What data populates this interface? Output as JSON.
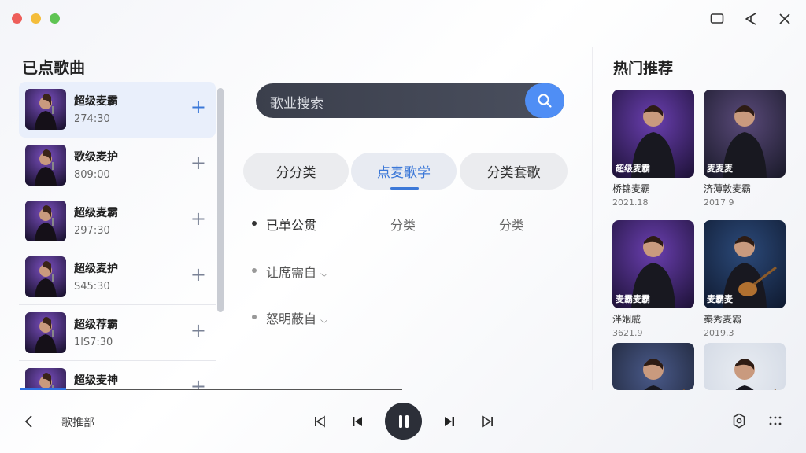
{
  "window": {
    "traffic_lights": [
      "#ee5e5a",
      "#f4bd3b",
      "#5fc453"
    ]
  },
  "left_panel": {
    "title": "已点歌曲",
    "items": [
      {
        "title": "超级麦霸",
        "sub": "274:30",
        "active": true
      },
      {
        "title": "歌级麦护",
        "sub": "809:00",
        "active": false
      },
      {
        "title": "超级麦霸",
        "sub": "297:30",
        "active": false
      },
      {
        "title": "超级麦护",
        "sub": "S45:30",
        "active": false
      },
      {
        "title": "超级荐霸",
        "sub": "1lS7:30",
        "active": false
      },
      {
        "title": "超级麦神",
        "sub": "",
        "active": false
      }
    ],
    "progress": 0.12
  },
  "search": {
    "placeholder": "歌业搜索"
  },
  "tabs": [
    {
      "label": "分分类",
      "active": false
    },
    {
      "label": "点麦歌学",
      "active": true
    },
    {
      "label": "分类套歌",
      "active": false
    }
  ],
  "options": {
    "row1": [
      "已单公贯",
      "分类",
      "分类"
    ],
    "dropdowns": [
      "让席需自",
      "怒明蔽自"
    ]
  },
  "right_panel": {
    "title": "热门推荐",
    "cards": [
      {
        "tag": "超级麦霸",
        "name": "桥锦麦霸",
        "sub": "2021.18"
      },
      {
        "tag": "麦麦麦",
        "name": "济薄敦麦霸",
        "sub": "2017 9"
      },
      {
        "tag": "麦霸麦霸",
        "name": "泮姻戚",
        "sub": "3621.9"
      },
      {
        "tag": "麦霸麦",
        "name": "秦秀麦霸",
        "sub": "2019.3"
      },
      {
        "tag": "",
        "name": "",
        "sub": ""
      },
      {
        "tag": "",
        "name": "",
        "sub": ""
      }
    ]
  },
  "bottom": {
    "label": "歌推部"
  },
  "colors": {
    "accent": "#3c78d8",
    "search_bg": "#3f4352",
    "search_btn": "#4f8ef5",
    "play_bg": "#2c2f38"
  }
}
